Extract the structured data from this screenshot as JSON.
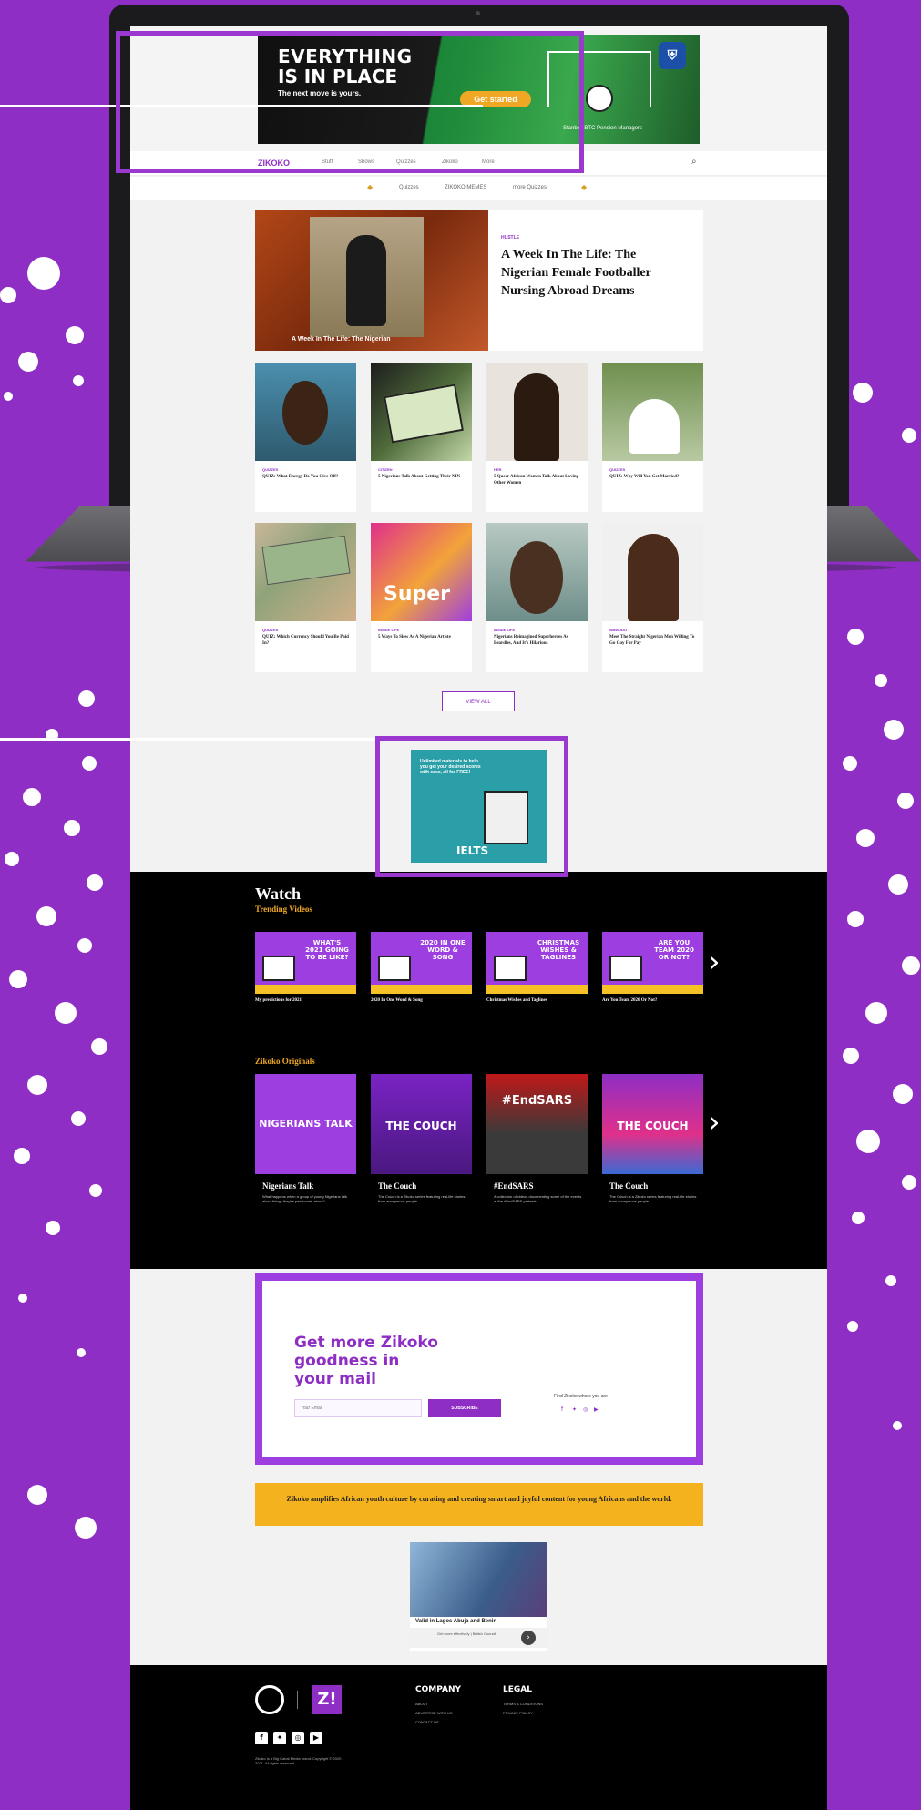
{
  "ad_banner": {
    "line1": "EVERYTHING",
    "line2": "IS IN PLACE",
    "subline": "The next move is yours.",
    "cta": "Get started",
    "brand_icon": "bank-shield-icon",
    "fine_print": "Stanbic IBTC Pension Managers"
  },
  "nav": {
    "logo": "ZIKOKO",
    "items": [
      "Stuff",
      "Shows",
      "Quizzes",
      "Zikoko",
      "More"
    ],
    "search_icon": "search-icon",
    "sub_items": [
      "Quizzes",
      "ZIKOKO MEMES",
      "more Quizzes"
    ]
  },
  "hero": {
    "image_caption": "A Week In The Life: The Nigerian",
    "tag": "HUSTLE",
    "title": "A Week In The Life: The Nigerian Female Footballer Nursing Abroad Dreams"
  },
  "articles": [
    {
      "tag": "QUIZZES",
      "title": "QUIZ: What Energy Do You Give Off?"
    },
    {
      "tag": "CITIZEN",
      "title": "5 Nigerians Talk About Getting Their NIN"
    },
    {
      "tag": "HER",
      "title": "5 Queer African Women Talk About Loving Other Women"
    },
    {
      "tag": "QUIZZES",
      "title": "QUIZ: Why Will You Get Married?"
    },
    {
      "tag": "QUIZZES",
      "title": "QUIZ: Which Currency Should You Be Paid In?"
    },
    {
      "tag": "INSIDE LIFE",
      "title": "5 Ways To Slow As A Nigerian Artiste"
    },
    {
      "tag": "INSIDE LIFE",
      "title": "Nigerians Reimagined Superheroes As Beardies, And It's Hilarious"
    },
    {
      "tag": "WAWODO",
      "title": "Meet The Straight Nigerian Men Willing To Go Gay For Pay"
    }
  ],
  "view_all": "VIEW ALL",
  "ad_ielts": {
    "text": "Unlimited materials to help you get your desired scores with ease, all for FREE!",
    "brand": "IELTS"
  },
  "watch": {
    "title": "Watch",
    "trending_label": "Trending Videos",
    "videos": [
      {
        "head": "WHAT'S 2021 GOING TO BE LIKE?",
        "label": "My predictions for 2021"
      },
      {
        "head": "2020 IN ONE WORD & SONG",
        "label": "2020 In One Word & Song"
      },
      {
        "head": "CHRISTMAS WISHES & TAGLINES",
        "label": "Christmas Wishes and Taglines"
      },
      {
        "head": "ARE YOU TEAM 2020 OR NOT?",
        "label": "Are You Team 2020 Or Not?"
      }
    ],
    "originals_label": "Zikoko Originals",
    "originals": [
      {
        "art": "NIGERIANS TALK",
        "name": "Nigerians Talk",
        "desc": "What happens when a group of young Nigerians talk about things they're passionate about?"
      },
      {
        "art": "THE COUCH",
        "name": "The Couch",
        "desc": "The Couch is a Zikoko series featuring real-life stories from anonymous people"
      },
      {
        "art": "#EndSARS",
        "name": "#EndSARS",
        "desc": "A collection of videos documenting some of the events at the #EndSARS protests"
      },
      {
        "art": "THE COUCH",
        "name": "The Couch",
        "desc": "The Couch is a Zikoko series featuring real-life stories from anonymous people"
      }
    ]
  },
  "newsletter": {
    "title": "Get more Zikoko goodness in your mail",
    "placeholder": "Your Email",
    "button": "SUBSCRIBE",
    "find_label": "Find Zikoko where you are",
    "social_icons": [
      "facebook-icon",
      "twitter-icon",
      "instagram-icon",
      "youtube-icon"
    ]
  },
  "mission": {
    "text": "Zikoko amplifies African youth culture by curating and creating smart and joyful content for young Africans and the world."
  },
  "ad_british": {
    "title": "Valid in Lagos Abuja and Benin",
    "small": "Get more effectively | British Council"
  },
  "footer": {
    "logo_text": "Z!",
    "company_head": "COMPANY",
    "company_links": [
      "ABOUT",
      "ADVERTISE WITH US",
      "CONTACT US"
    ],
    "legal_head": "LEGAL",
    "legal_links": [
      "TERMS & CONDITIONS",
      "PRIVACY POLICY"
    ],
    "copyright": "Zikoko is a Big Cabal Media brand. Copyright © 2020 - 2021. All rights reserved."
  },
  "colors": {
    "brand_purple": "#8e2ec4",
    "accent_yellow": "#f5b21f",
    "black": "#000000"
  }
}
